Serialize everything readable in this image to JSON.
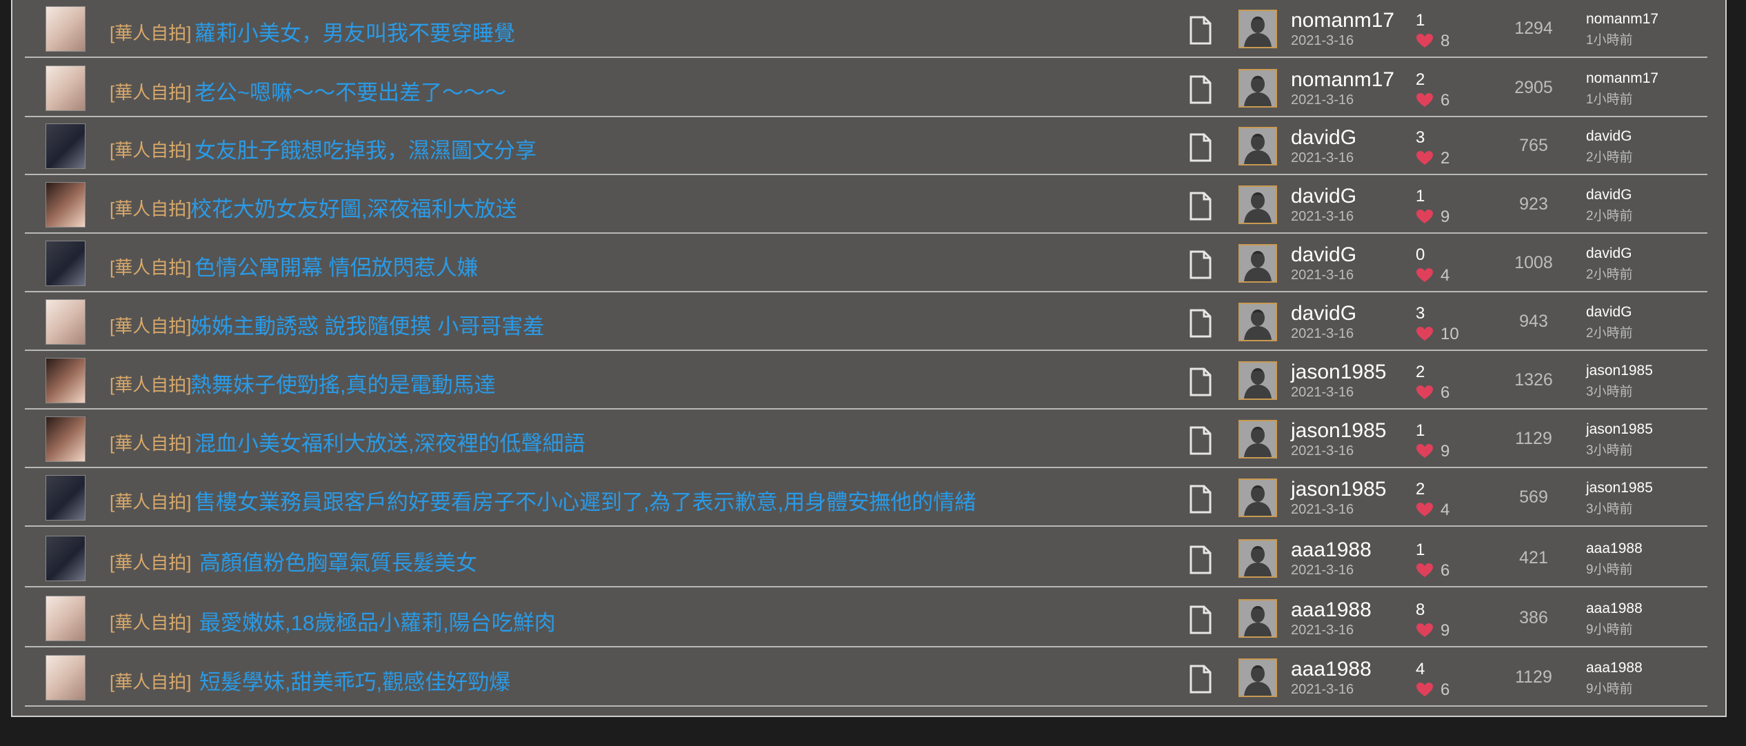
{
  "threads": [
    {
      "category": "[華人自拍]",
      "title": "蘿莉小美女，男友叫我不要穿睡覺",
      "author": "nomanm17",
      "date": "2021-3-16",
      "replies": "1",
      "likes": "8",
      "views": "1294",
      "last_user": "nomanm17",
      "last_time": "1小時前"
    },
    {
      "category": "[華人自拍]",
      "title": "老公~嗯嘛～～不要出差了～～～",
      "author": "nomanm17",
      "date": "2021-3-16",
      "replies": "2",
      "likes": "6",
      "views": "2905",
      "last_user": "nomanm17",
      "last_time": "1小時前"
    },
    {
      "category": "[華人自拍]",
      "title": "女友肚子餓想吃掉我，濕濕圖文分享",
      "author": "davidG",
      "date": "2021-3-16",
      "replies": "3",
      "likes": "2",
      "views": "765",
      "last_user": "davidG",
      "last_time": "2小時前"
    },
    {
      "category": "[華人自拍]",
      "title": "校花大奶女友好圖,深夜福利大放送",
      "author": "davidG",
      "date": "2021-3-16",
      "replies": "1",
      "likes": "9",
      "views": "923",
      "last_user": "davidG",
      "last_time": "2小時前"
    },
    {
      "category": "[華人自拍]",
      "title": "色情公寓開幕  情侶放閃惹人嫌",
      "author": "davidG",
      "date": "2021-3-16",
      "replies": "0",
      "likes": "4",
      "views": "1008",
      "last_user": "davidG",
      "last_time": "2小時前"
    },
    {
      "category": "[華人自拍]",
      "title": "姊姊主動誘惑 說我隨便摸 小哥哥害羞",
      "author": "davidG",
      "date": "2021-3-16",
      "replies": "3",
      "likes": "10",
      "views": "943",
      "last_user": "davidG",
      "last_time": "2小時前"
    },
    {
      "category": "[華人自拍]",
      "title": "熱舞妹子使勁搖,真的是電動馬達",
      "author": "jason1985",
      "date": "2021-3-16",
      "replies": "2",
      "likes": "6",
      "views": "1326",
      "last_user": "jason1985",
      "last_time": "3小時前"
    },
    {
      "category": "[華人自拍]",
      "title": "混血小美女福利大放送,深夜裡的低聲細語",
      "author": "jason1985",
      "date": "2021-3-16",
      "replies": "1",
      "likes": "9",
      "views": "1129",
      "last_user": "jason1985",
      "last_time": "3小時前"
    },
    {
      "category": "[華人自拍]",
      "title": "售樓女業務員跟客戶約好要看房子不小心遲到了,為了表示歉意,用身體安撫他的情緒",
      "author": "jason1985",
      "date": "2021-3-16",
      "replies": "2",
      "likes": "4",
      "views": "569",
      "last_user": "jason1985",
      "last_time": "3小時前"
    },
    {
      "category": "[華人自拍]",
      "title": "高顏值粉色胸罩氣質長髮美女",
      "author": "aaa1988",
      "date": "2021-3-16",
      "replies": "1",
      "likes": "6",
      "views": "421",
      "last_user": "aaa1988",
      "last_time": "9小時前"
    },
    {
      "category": "[華人自拍]",
      "title": "最愛嫩妹,18歲極品小蘿莉,陽台吃鮮肉",
      "author": "aaa1988",
      "date": "2021-3-16",
      "replies": "8",
      "likes": "9",
      "views": "386",
      "last_user": "aaa1988",
      "last_time": "9小時前"
    },
    {
      "category": "[華人自拍]",
      "title": "短髮學妹,甜美乖巧,觀感佳好勁爆",
      "author": "aaa1988",
      "date": "2021-3-16",
      "replies": "4",
      "likes": "6",
      "views": "1129",
      "last_user": "aaa1988",
      "last_time": "9小時前"
    }
  ],
  "icons": {
    "thread_type": "document-icon",
    "author_avatar": "default-avatar-icon",
    "likes": "heart-icon"
  },
  "colors": {
    "category": "#d8a86a",
    "title_link": "#2a9ae6",
    "heart": "#e0405a",
    "avatar_border": "#c99a52"
  }
}
